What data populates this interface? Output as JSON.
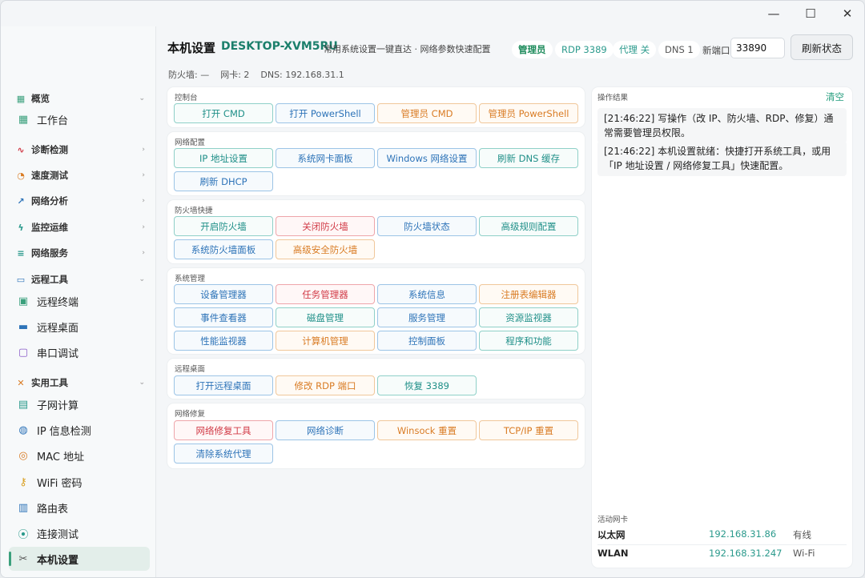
{
  "window": {
    "minimize": "—",
    "maximize": "☐",
    "close": "✕"
  },
  "sidebar": {
    "groups": [
      {
        "id": "overview",
        "label": "概览",
        "icon": "grid-icon"
      },
      {
        "id": "diag",
        "label": "诊断检测",
        "icon": "pulse-icon"
      },
      {
        "id": "speed",
        "label": "速度测试",
        "icon": "gauge-icon"
      },
      {
        "id": "analysis",
        "label": "网络分析",
        "icon": "trend-icon"
      },
      {
        "id": "monitor",
        "label": "监控运维",
        "icon": "bolt-icon"
      },
      {
        "id": "services",
        "label": "网络服务",
        "icon": "database-icon"
      },
      {
        "id": "remote",
        "label": "远程工具",
        "icon": "terminal-icon"
      },
      {
        "id": "utilities",
        "label": "实用工具",
        "icon": "wrench-icon"
      }
    ],
    "items": {
      "workbench": "工作台",
      "remote_terminal": "远程终端",
      "remote_desktop": "远程桌面",
      "serial_debug": "串口调试",
      "subnet_calc": "子网计算",
      "ip_check": "IP 信息检测",
      "mac_addr": "MAC 地址",
      "wifi_pwd": "WiFi 密码",
      "route_table": "路由表",
      "conn_test": "连接测试",
      "local_settings": "本机设置"
    }
  },
  "header": {
    "title": "本机设置",
    "hostname": "DESKTOP-XVM5RU",
    "subtitle": "常用系统设置一键直达 · 网络参数快速配置",
    "info": "防火墙: —    网卡: 2    DNS: 192.168.31.1",
    "chips": {
      "admin": "管理员",
      "rdp": "RDP 3389",
      "proxy": "代理 关",
      "dns": "DNS 1"
    },
    "port_label": "新端口",
    "port_value": "33890",
    "refresh": "刷新状态"
  },
  "sections": {
    "console": {
      "title": "控制台",
      "buttons": [
        "打开 CMD",
        "打开 PowerShell",
        "管理员 CMD",
        "管理员 PowerShell"
      ]
    },
    "network": {
      "title": "网络配置",
      "buttons": [
        "IP 地址设置",
        "系统网卡面板",
        "Windows 网络设置",
        "刷新 DNS 缓存",
        "刷新 DHCP"
      ]
    },
    "firewall": {
      "title": "防火墙快捷",
      "buttons": [
        "开启防火墙",
        "关闭防火墙",
        "防火墙状态",
        "高级规则配置",
        "系统防火墙面板",
        "高级安全防火墙"
      ]
    },
    "system": {
      "title": "系统管理",
      "buttons": [
        "设备管理器",
        "任务管理器",
        "系统信息",
        "注册表编辑器",
        "事件查看器",
        "磁盘管理",
        "服务管理",
        "资源监视器",
        "性能监视器",
        "计算机管理",
        "控制面板",
        "程序和功能"
      ]
    },
    "rdp": {
      "title": "远程桌面",
      "buttons": [
        "打开远程桌面",
        "修改 RDP 端口",
        "恢复 3389"
      ]
    },
    "repair": {
      "title": "网络修复",
      "buttons": [
        "网络修复工具",
        "网络诊断",
        "Winsock 重置",
        "TCP/IP 重置",
        "清除系统代理"
      ]
    }
  },
  "results": {
    "title": "操作结果",
    "clear": "清空",
    "logs": [
      "[21:46:22] 写操作（改 IP、防火墙、RDP、修复）通常需要管理员权限。",
      "[21:46:22] 本机设置就绪：快捷打开系统工具，或用「IP 地址设置 / 网络修复工具」快速配置。"
    ]
  },
  "nics": {
    "title": "活动网卡",
    "rows": [
      {
        "name": "以太网",
        "ip": "192.168.31.86",
        "type": "有线"
      },
      {
        "name": "WLAN",
        "ip": "192.168.31.247",
        "type": "Wi-Fi"
      }
    ]
  },
  "colors": {
    "accent": "#1b7f6b",
    "teal": "#1f8f88",
    "blue": "#2d73b8",
    "orange": "#d97b23",
    "red": "#d13a46"
  }
}
